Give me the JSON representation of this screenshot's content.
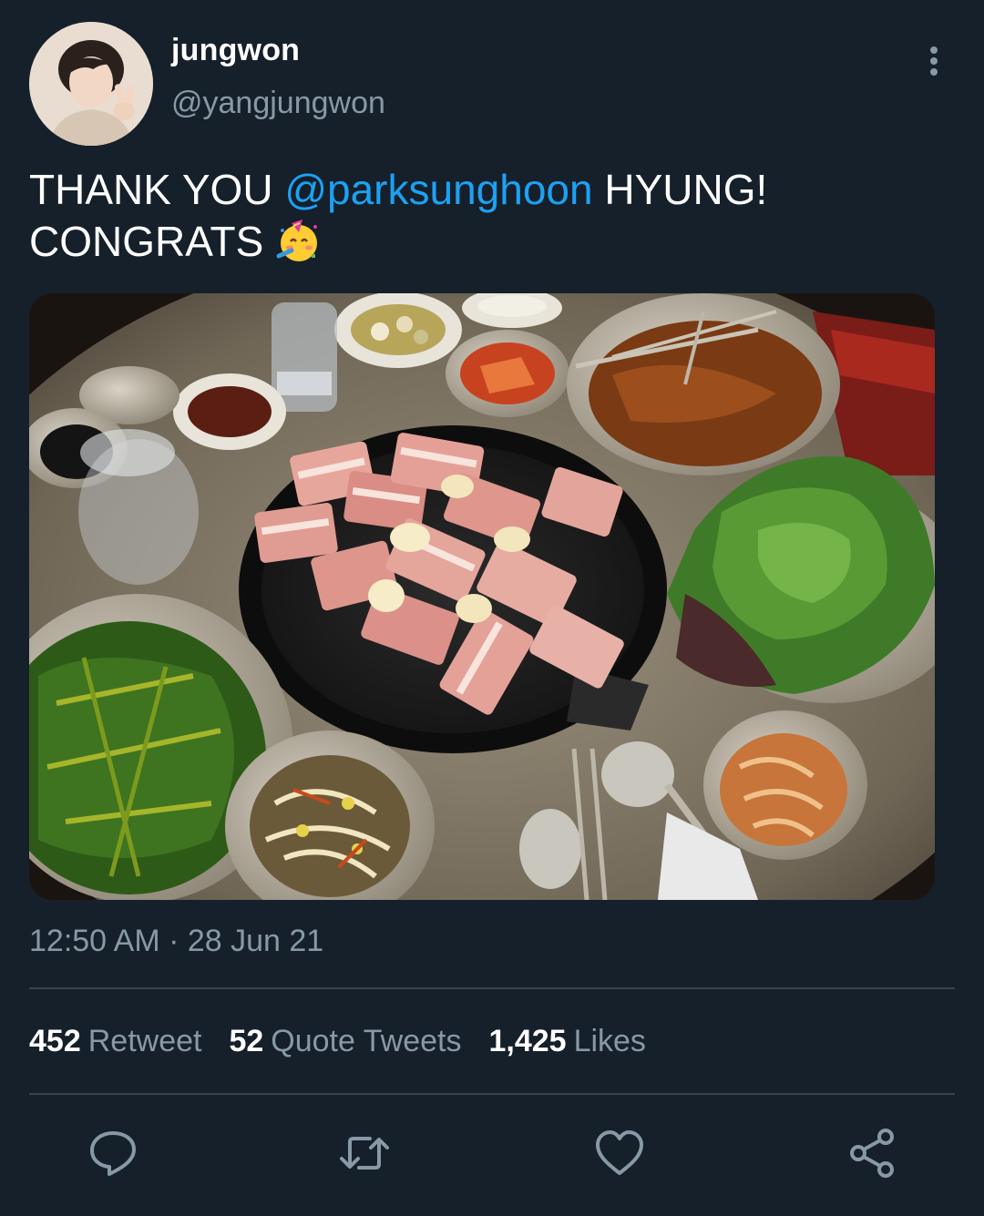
{
  "author": {
    "display_name": "jungwon",
    "handle": "@yangjungwon"
  },
  "tweet": {
    "text_part1": "THANK YOU ",
    "mention": "@parksunghoon",
    "text_part2": " HYUNG!",
    "text_line2": "CONGRATS ",
    "emoji": "partying-face"
  },
  "timestamp": "12:50 AM · 28 Jun 21",
  "stats": {
    "retweets_count": "452",
    "retweets_label": "Retweet",
    "quotes_count": "52",
    "quotes_label": "Quote Tweets",
    "likes_count": "1,425",
    "likes_label": "Likes"
  },
  "icons": {
    "more": "more-vertical-icon",
    "reply": "reply-icon",
    "retweet": "retweet-icon",
    "like": "heart-icon",
    "share": "share-icon"
  },
  "colors": {
    "background": "#15202b",
    "secondary_text": "#8899a6",
    "link": "#1da1f2",
    "divider": "#38444d"
  }
}
